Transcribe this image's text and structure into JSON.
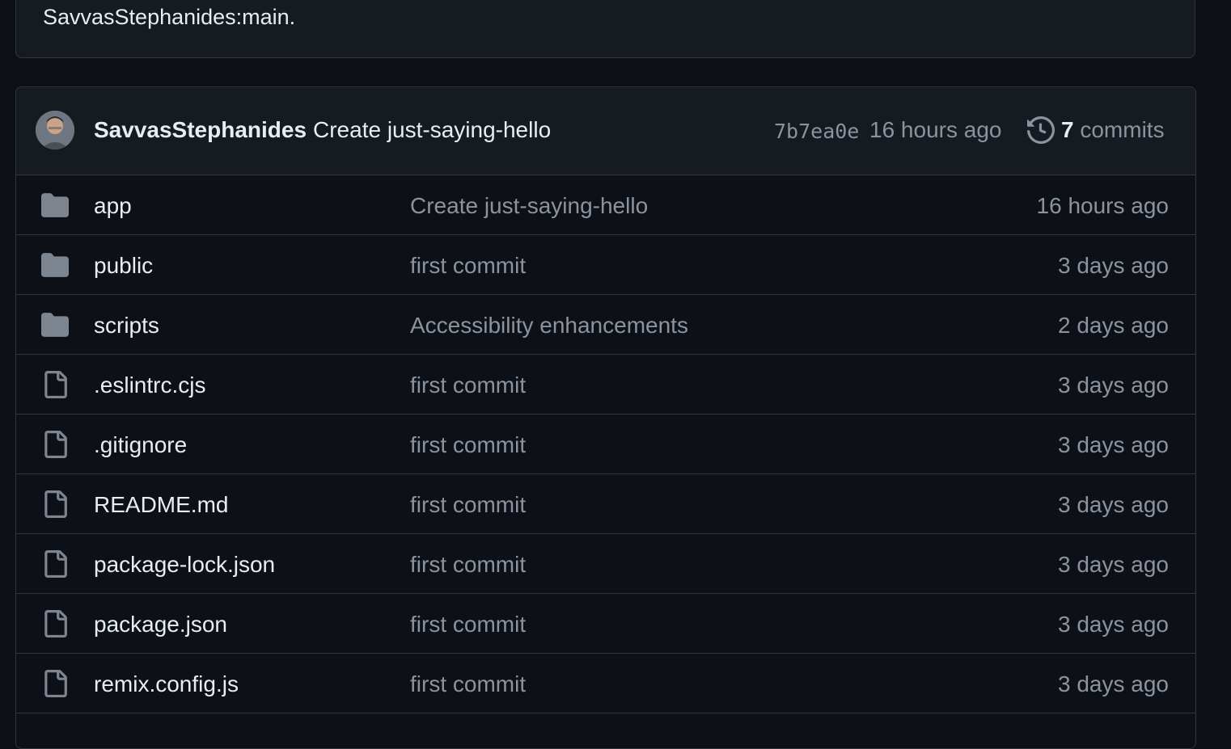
{
  "merge_banner": {
    "message": "SavvasStephanides:main."
  },
  "latest_commit": {
    "author": "SavvasStephanides",
    "message": "Create just-saying-hello",
    "sha": "7b7ea0e",
    "time": "16 hours ago",
    "commit_count": "7",
    "commit_count_label": "commits"
  },
  "files": [
    {
      "name": "app",
      "type": "folder",
      "commit_message": "Create just-saying-hello",
      "age": "16 hours ago",
      "icon": "folder-icon"
    },
    {
      "name": "public",
      "type": "folder",
      "commit_message": "first commit",
      "age": "3 days ago",
      "icon": "folder-icon"
    },
    {
      "name": "scripts",
      "type": "folder",
      "commit_message": "Accessibility enhancements",
      "age": "2 days ago",
      "icon": "folder-icon"
    },
    {
      "name": ".eslintrc.cjs",
      "type": "file",
      "commit_message": "first commit",
      "age": "3 days ago",
      "icon": "file-icon"
    },
    {
      "name": ".gitignore",
      "type": "file",
      "commit_message": "first commit",
      "age": "3 days ago",
      "icon": "file-icon"
    },
    {
      "name": "README.md",
      "type": "file",
      "commit_message": "first commit",
      "age": "3 days ago",
      "icon": "file-icon"
    },
    {
      "name": "package-lock.json",
      "type": "file",
      "commit_message": "first commit",
      "age": "3 days ago",
      "icon": "file-icon"
    },
    {
      "name": "package.json",
      "type": "file",
      "commit_message": "first commit",
      "age": "3 days ago",
      "icon": "file-icon"
    },
    {
      "name": "remix.config.js",
      "type": "file",
      "commit_message": "first commit",
      "age": "3 days ago",
      "icon": "file-icon"
    }
  ],
  "colors": {
    "background": "#0d1117",
    "header_bg": "#161b22",
    "border": "#30363d",
    "text_primary": "#e6edf3",
    "text_muted": "#8b949e",
    "icon_color": "#7d8590"
  }
}
